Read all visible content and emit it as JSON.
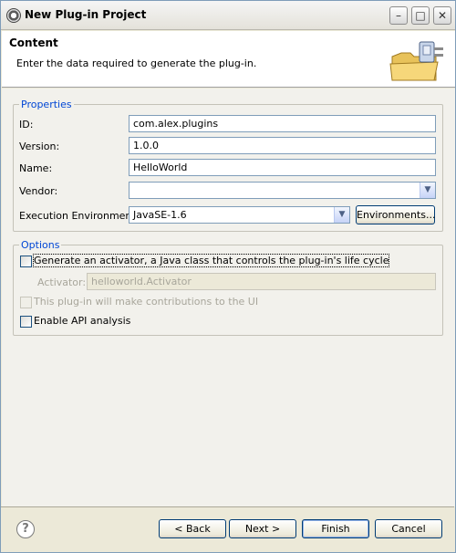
{
  "window": {
    "title": "New Plug-in Project",
    "minimize_glyph": "–",
    "maximize_glyph": "□",
    "close_glyph": "✕"
  },
  "header": {
    "title": "Content",
    "description": "Enter the data required to generate the plug-in."
  },
  "properties": {
    "legend": "Properties",
    "id_label": "ID:",
    "id_value": "com.alex.plugins",
    "version_label": "Version:",
    "version_value": "1.0.0",
    "name_label": "Name:",
    "name_value": "HelloWorld",
    "vendor_label": "Vendor:",
    "vendor_value": "",
    "env_label": "Execution Environment:",
    "env_value": "JavaSE-1.6",
    "environments_button": "Environments..."
  },
  "options": {
    "legend": "Options",
    "generate_activator_label": "Generate an activator, a Java class that controls the plug-in's life cycle",
    "generate_activator_checked": false,
    "activator_label": "Activator:",
    "activator_value": "helloworld.Activator",
    "ui_contrib_label": "This plug-in will make contributions to the UI",
    "ui_contrib_checked": false,
    "api_analysis_label": "Enable API analysis",
    "api_analysis_checked": false
  },
  "footer": {
    "help_glyph": "?",
    "back_label": "< Back",
    "next_label": "Next >",
    "finish_label": "Finish",
    "cancel_label": "Cancel"
  },
  "icons": {
    "window_icon": "eclipse-icon",
    "wizard_banner": "folder-plug-icon",
    "combo_arrow": "chevron-down-icon",
    "help": "help-icon"
  }
}
